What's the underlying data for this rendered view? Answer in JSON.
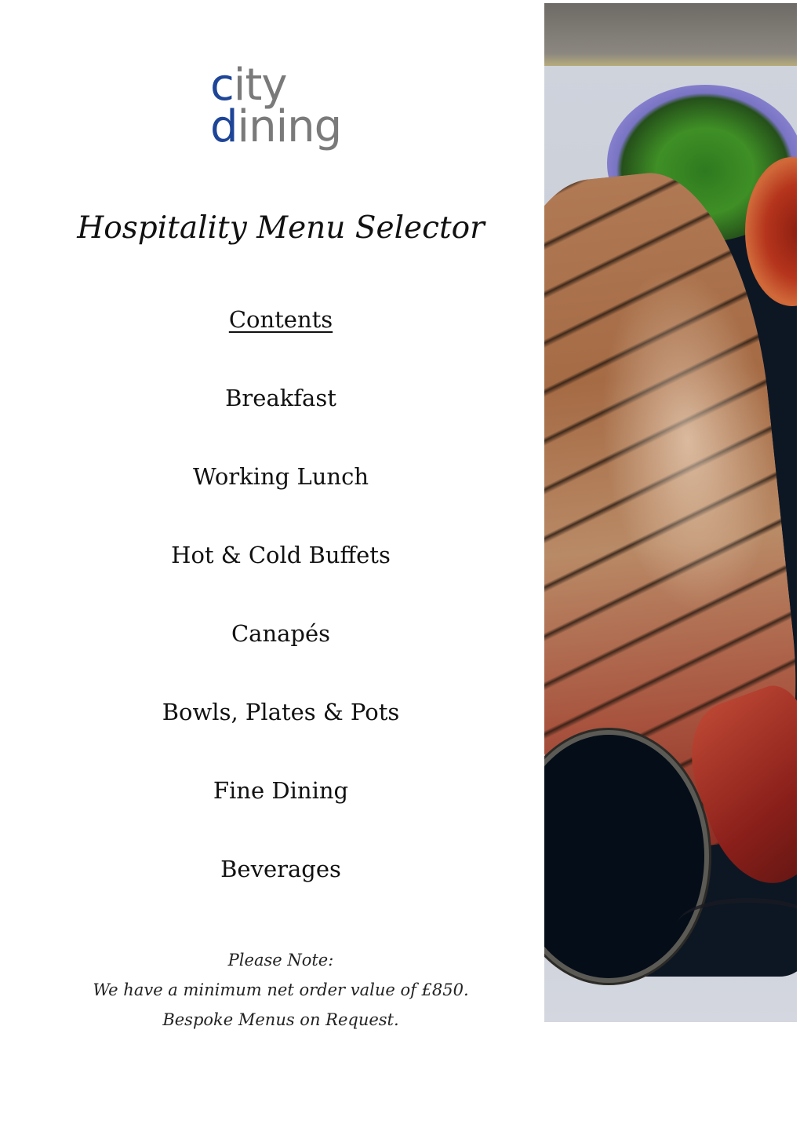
{
  "logo": {
    "line1_accent": "c",
    "line1_rest": "ity",
    "line2_accent": "d",
    "line2_rest": "ining",
    "accent_color": "#1e4597",
    "text_color": "#7a7a7a"
  },
  "title": "Hospitality Menu Selector",
  "contents": {
    "heading": "Contents",
    "items": [
      "Breakfast",
      "Working Lunch",
      "Hot & Cold Buffets",
      "Canapés",
      "Bowls, Plates & Pots",
      "Fine Dining",
      "Beverages"
    ]
  },
  "note": {
    "label": "Please Note:",
    "minimum_order": "We have a minimum net order value of £850.",
    "bespoke": "Bespoke Menus on Request."
  },
  "photo": {
    "subject": "grilled whole red fish on a decorated platter with herb and sauce bowls"
  }
}
